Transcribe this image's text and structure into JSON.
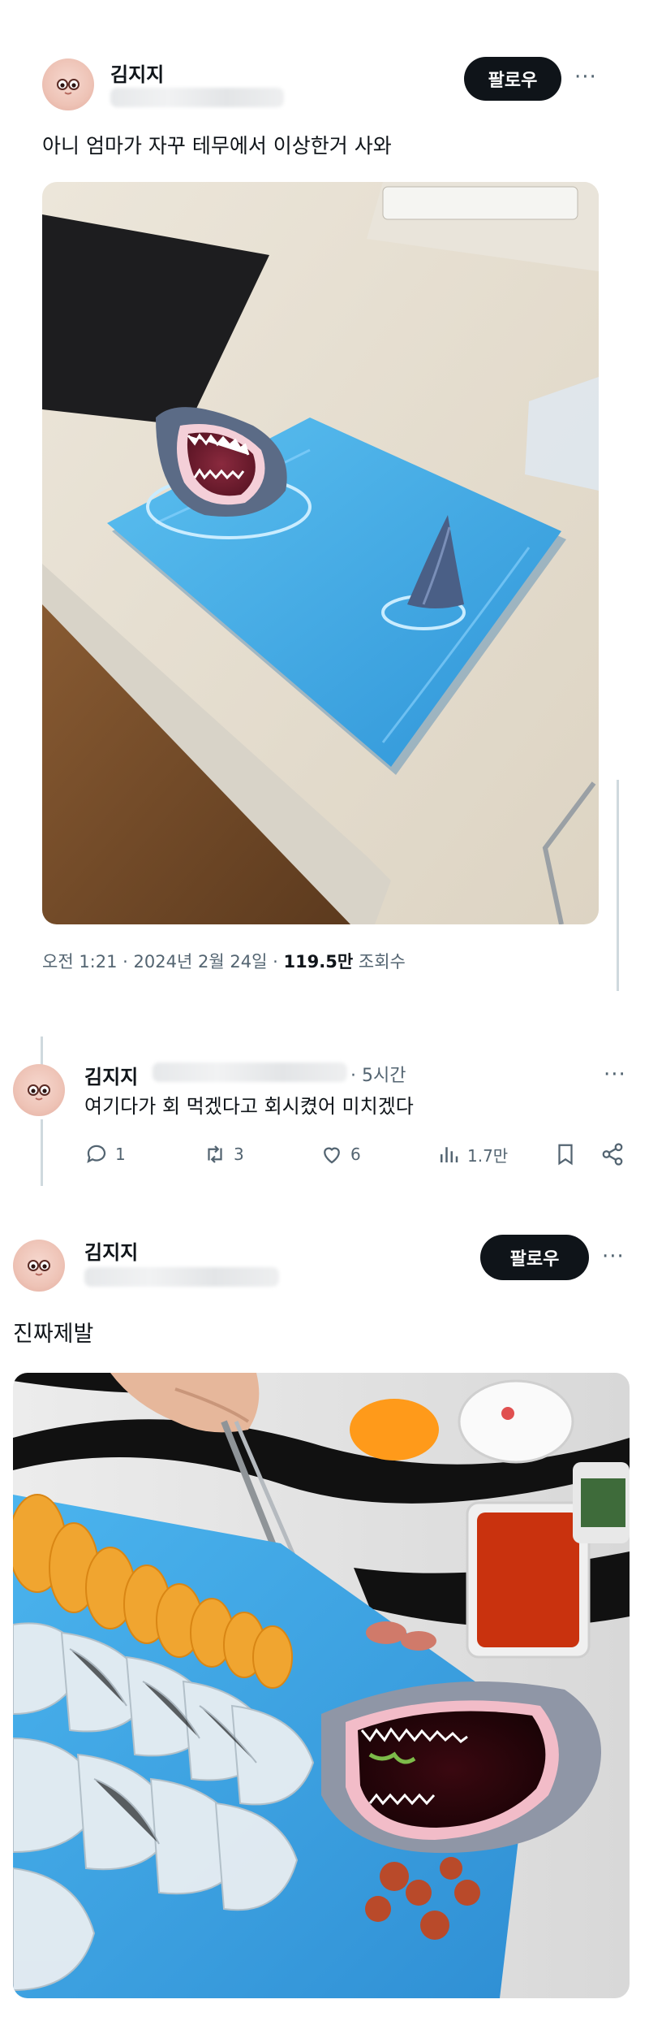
{
  "post1": {
    "author": "김지지",
    "follow_label": "팔로우",
    "more_label": "···",
    "text": "아니 엄마가 자꾸 테무에서 이상한거 사와",
    "time": "오전 1:21",
    "sep1": "·",
    "date": "2024년 2월 24일",
    "sep2": "·",
    "views_count": "119.5만",
    "views_label": "조회수"
  },
  "reply": {
    "author": "김지지",
    "time_prefix": "·",
    "time": "5시간",
    "more_label": "···",
    "text": "여기다가 회 먹겠다고 회시켰어 미치겠다",
    "replies_count": "1",
    "retweets_count": "3",
    "likes_count": "6",
    "views_count": "1.7만"
  },
  "post2": {
    "author": "김지지",
    "follow_label": "팔로우",
    "more_label": "···",
    "text": "진짜제발"
  },
  "icons": {
    "more": "more-dots-icon",
    "reply": "speech-bubble-icon",
    "retweet": "retweet-arrows-icon",
    "like": "heart-icon",
    "views": "bar-chart-icon",
    "bookmark": "bookmark-icon",
    "share": "share-nodes-icon"
  },
  "colors": {
    "text": "#0f1419",
    "muted": "#536471",
    "follow_bg": "#0f1419",
    "divider": "#cfd9de",
    "board_blue": "#3fa8e6"
  }
}
